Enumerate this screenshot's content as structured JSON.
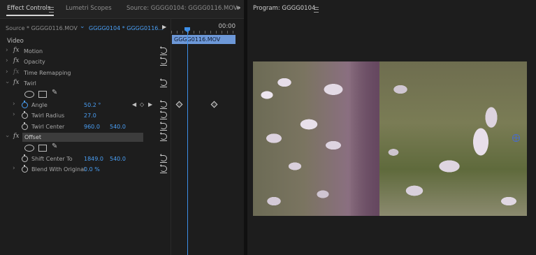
{
  "effect_controls": {
    "tabs": [
      {
        "label": "Effect Controls",
        "active": true
      },
      {
        "label": "Lumetri Scopes",
        "active": false
      },
      {
        "label": "Source: GGGG0104: GGGG0116.MOV:",
        "active": false
      }
    ],
    "source_label": "Source * GGGG0116.MOV",
    "clip_label": "GGGG0104 * GGGG0116...",
    "section_label": "Video",
    "rows": {
      "motion": "Motion",
      "opacity": "Opacity",
      "time_remapping": "Time Remapping",
      "twirl": "Twirl",
      "angle_label": "Angle",
      "angle_value": "50.2 °",
      "twirl_radius_label": "Twirl Radius",
      "twirl_radius_value": "27.0",
      "twirl_center_label": "Twirl Center",
      "twirl_center_x": "960.0",
      "twirl_center_y": "540.0",
      "offset": "Offset",
      "shift_center_label": "Shift Center To",
      "shift_center_x": "1849.0",
      "shift_center_y": "540.0",
      "blend_label": "Blend With Original",
      "blend_value": "0.0 %"
    },
    "fx_symbol": "fx",
    "timeline": {
      "timecode": "00:00",
      "clip_name": "GGGG0116.MOV"
    }
  },
  "program_monitor": {
    "title": "Program: GGGG0104"
  },
  "colors": {
    "accent_blue": "#4a9ff5",
    "playhead": "#3d8fe8",
    "clip_bar": "#6d98d8",
    "panel_bg": "#1d1d1d"
  }
}
